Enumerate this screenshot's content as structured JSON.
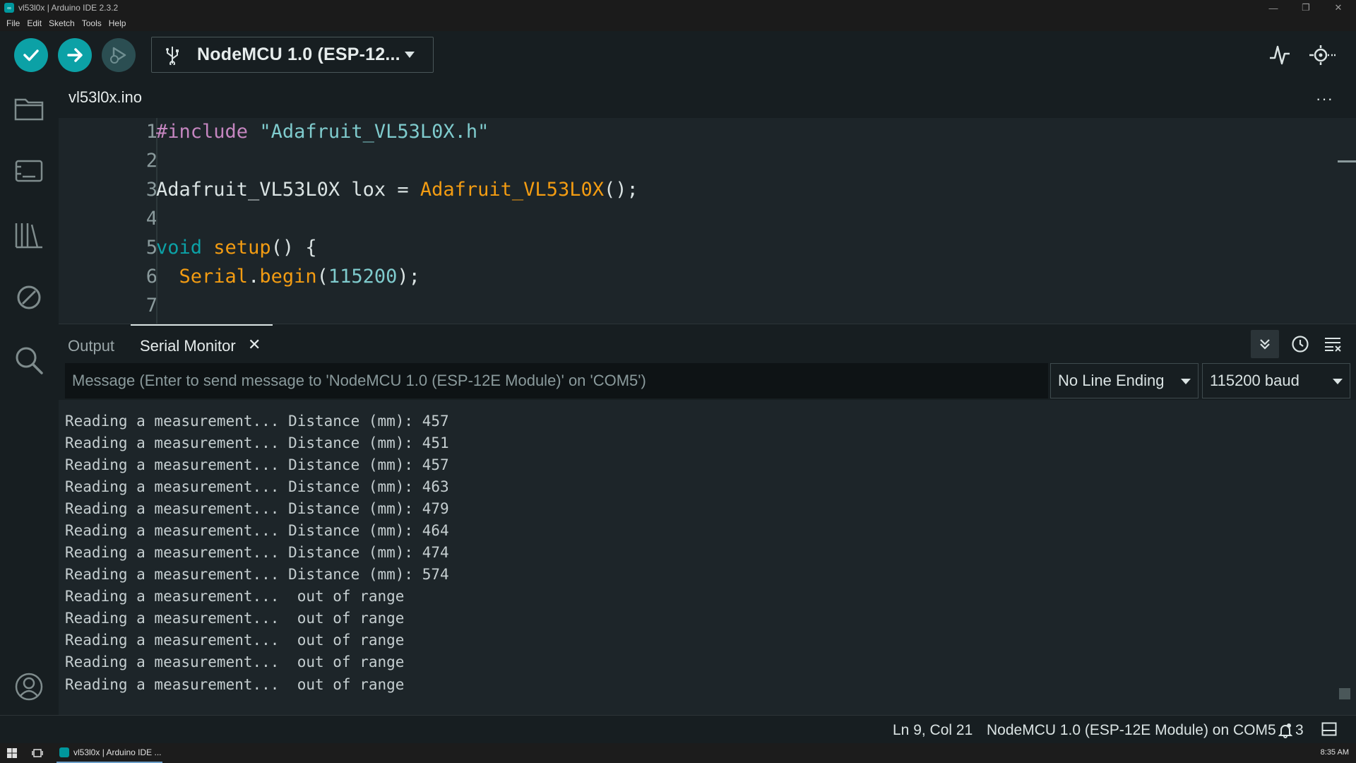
{
  "window": {
    "title": "vl53l0x | Arduino IDE 2.3.2",
    "controls": {
      "minimize": "—",
      "restore": "❐",
      "close": "✕"
    }
  },
  "menu": [
    "File",
    "Edit",
    "Sketch",
    "Tools",
    "Help"
  ],
  "toolbar": {
    "verify_icon": "check-icon",
    "upload_icon": "arrow-right-icon",
    "debug_icon": "debug-icon",
    "board_name": "NodeMCU 1.0 (ESP-12...",
    "serial_plotter_icon": "pulse-icon",
    "serial_monitor_icon": "serial-monitor-icon"
  },
  "sidebar": [
    "folder-icon",
    "board-icon",
    "library-icon",
    "debug-disabled-icon",
    "search-icon",
    "account-icon"
  ],
  "editor": {
    "file_tab": "vl53l0x.ino",
    "more": "···",
    "line_numbers": [
      "1",
      "2",
      "3",
      "4",
      "5",
      "6",
      "7"
    ],
    "code": {
      "l1_pp": "#include",
      "l1_str": "\"Adafruit_VL53L0X.h\"",
      "l3_type": "Adafruit_VL53L0X lox = ",
      "l3_fn": "Adafruit_VL53L0X",
      "l3_end": "();",
      "l5_kw": "void",
      "l5_fn": "setup",
      "l5_end": "() {",
      "l6_fn1": "Serial",
      "l6_dot": ".",
      "l6_fn2": "begin",
      "l6_open": "(",
      "l6_num": "115200",
      "l6_close": ");"
    }
  },
  "panel": {
    "tabs": {
      "output": "Output",
      "serial_monitor": "Serial Monitor",
      "close": "✕"
    },
    "message_placeholder": "Message (Enter to send message to 'NodeMCU 1.0 (ESP-12E Module)' on 'COM5')",
    "line_ending": "No Line Ending",
    "baud": "115200 baud",
    "lines": [
      "Reading a measurement... Distance (mm): 457",
      "Reading a measurement... Distance (mm): 451",
      "Reading a measurement... Distance (mm): 457",
      "Reading a measurement... Distance (mm): 463",
      "Reading a measurement... Distance (mm): 479",
      "Reading a measurement... Distance (mm): 464",
      "Reading a measurement... Distance (mm): 474",
      "Reading a measurement... Distance (mm): 574",
      "Reading a measurement...  out of range",
      "Reading a measurement...  out of range",
      "Reading a measurement...  out of range",
      "Reading a measurement...  out of range",
      "Reading a measurement...  out of range"
    ]
  },
  "status": {
    "position": "Ln 9, Col 21",
    "board_port": "NodeMCU 1.0 (ESP-12E Module) on COM5",
    "notifications": "3"
  },
  "taskbar": {
    "app_label": "vl53l0x | Arduino IDE ...",
    "time": "8:35 AM"
  },
  "colors": {
    "accent": "#0ca1a6",
    "background": "#171e21",
    "editor_bg": "#1d2529"
  }
}
